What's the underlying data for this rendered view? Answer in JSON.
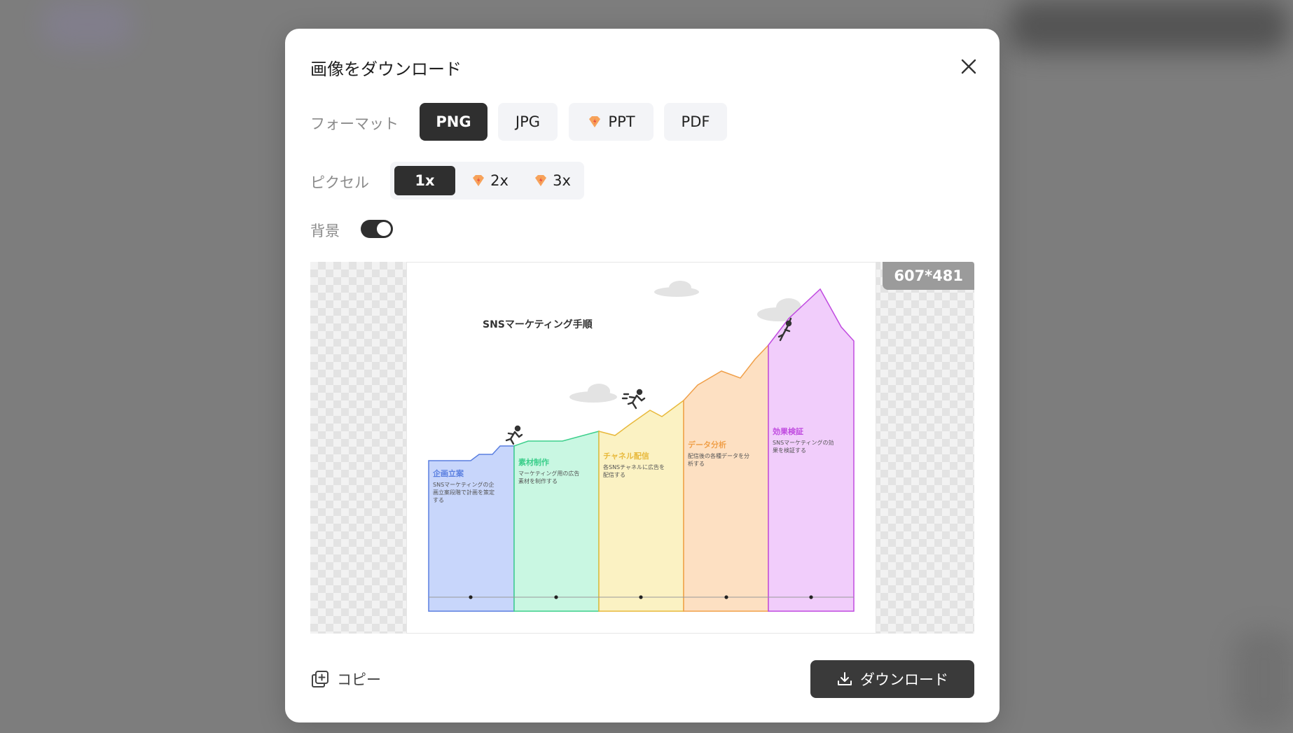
{
  "dialog": {
    "title": "画像をダウンロード"
  },
  "format": {
    "label": "フォーマット",
    "options": [
      "PNG",
      "JPG",
      "PPT",
      "PDF"
    ],
    "selected": "PNG"
  },
  "pixel": {
    "label": "ピクセル",
    "options": [
      "1x",
      "2x",
      "3x"
    ],
    "selected": "1x"
  },
  "background": {
    "label": "背景",
    "enabled": true
  },
  "preview": {
    "size_label": "607*481",
    "infographic": {
      "title": "SNSマーケティング手順",
      "steps": [
        {
          "title": "企画立案",
          "desc": [
            "SNSマーケティングの企",
            "画立案段階で計画を策定",
            "する"
          ],
          "color": "#5a7fe0",
          "fill": "#c8d6fb"
        },
        {
          "title": "素材制作",
          "desc": [
            "マーケティング用の広告",
            "素材を制作する"
          ],
          "color": "#3dcf8c",
          "fill": "#c9f7e2"
        },
        {
          "title": "チャネル配信",
          "desc": [
            "各SNSチャネルに広告を",
            "配信する"
          ],
          "color": "#e8b93c",
          "fill": "#fbf2c3"
        },
        {
          "title": "データ分析",
          "desc": [
            "配信後の各種データを分",
            "析する"
          ],
          "color": "#f0a04a",
          "fill": "#fde0c2"
        },
        {
          "title": "効果検証",
          "desc": [
            "SNSマーケティングの効",
            "果を検証する"
          ],
          "color": "#c04be0",
          "fill": "#f1cdfb"
        }
      ]
    }
  },
  "actions": {
    "copy": "コピー",
    "download": "ダウンロード"
  },
  "icons": {
    "close": "close-icon",
    "premium": "premium-diamond-icon",
    "copy": "copy-icon",
    "download": "download-icon"
  }
}
